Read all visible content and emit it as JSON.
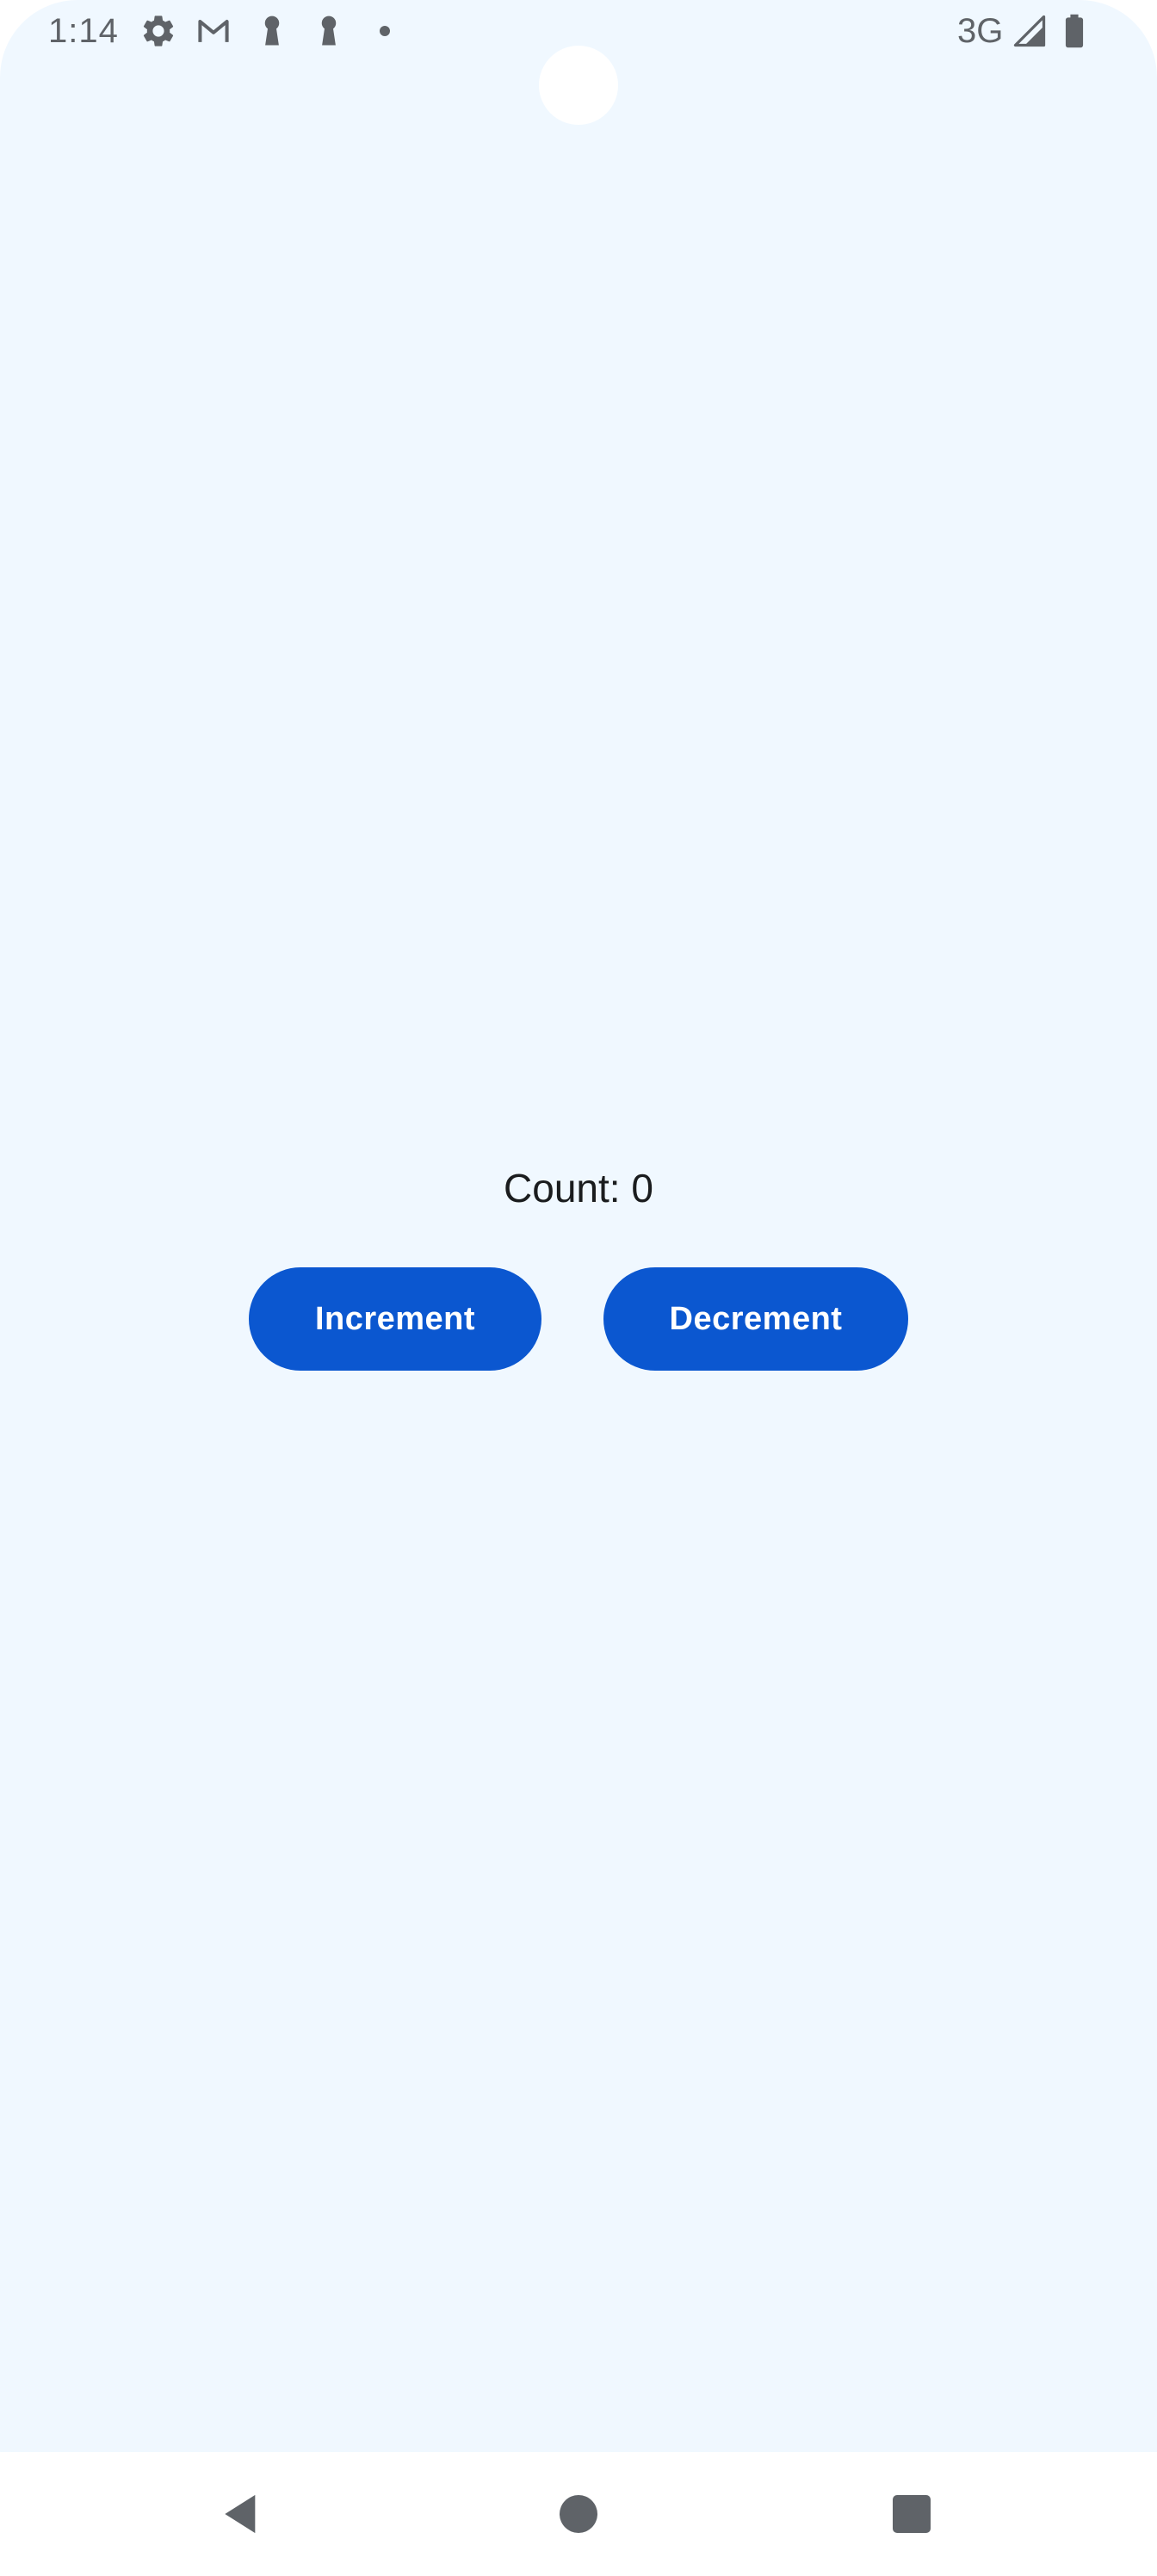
{
  "status_bar": {
    "time": "1:14",
    "network": "3G",
    "icons": [
      "settings-icon",
      "gmail-icon",
      "keyhole-icon",
      "keyhole-icon",
      "notification-dot",
      "signal-icon",
      "battery-icon"
    ]
  },
  "main": {
    "count_text": "Count: 0",
    "increment_label": "Increment",
    "decrement_label": "Decrement"
  },
  "navigation": {
    "icons": [
      "back-icon",
      "home-icon",
      "recents-icon"
    ]
  },
  "colors": {
    "background": "#f0f8ff",
    "button": "#0b57d0",
    "button_text": "#ffffff",
    "status_icons": "#5f6368"
  }
}
